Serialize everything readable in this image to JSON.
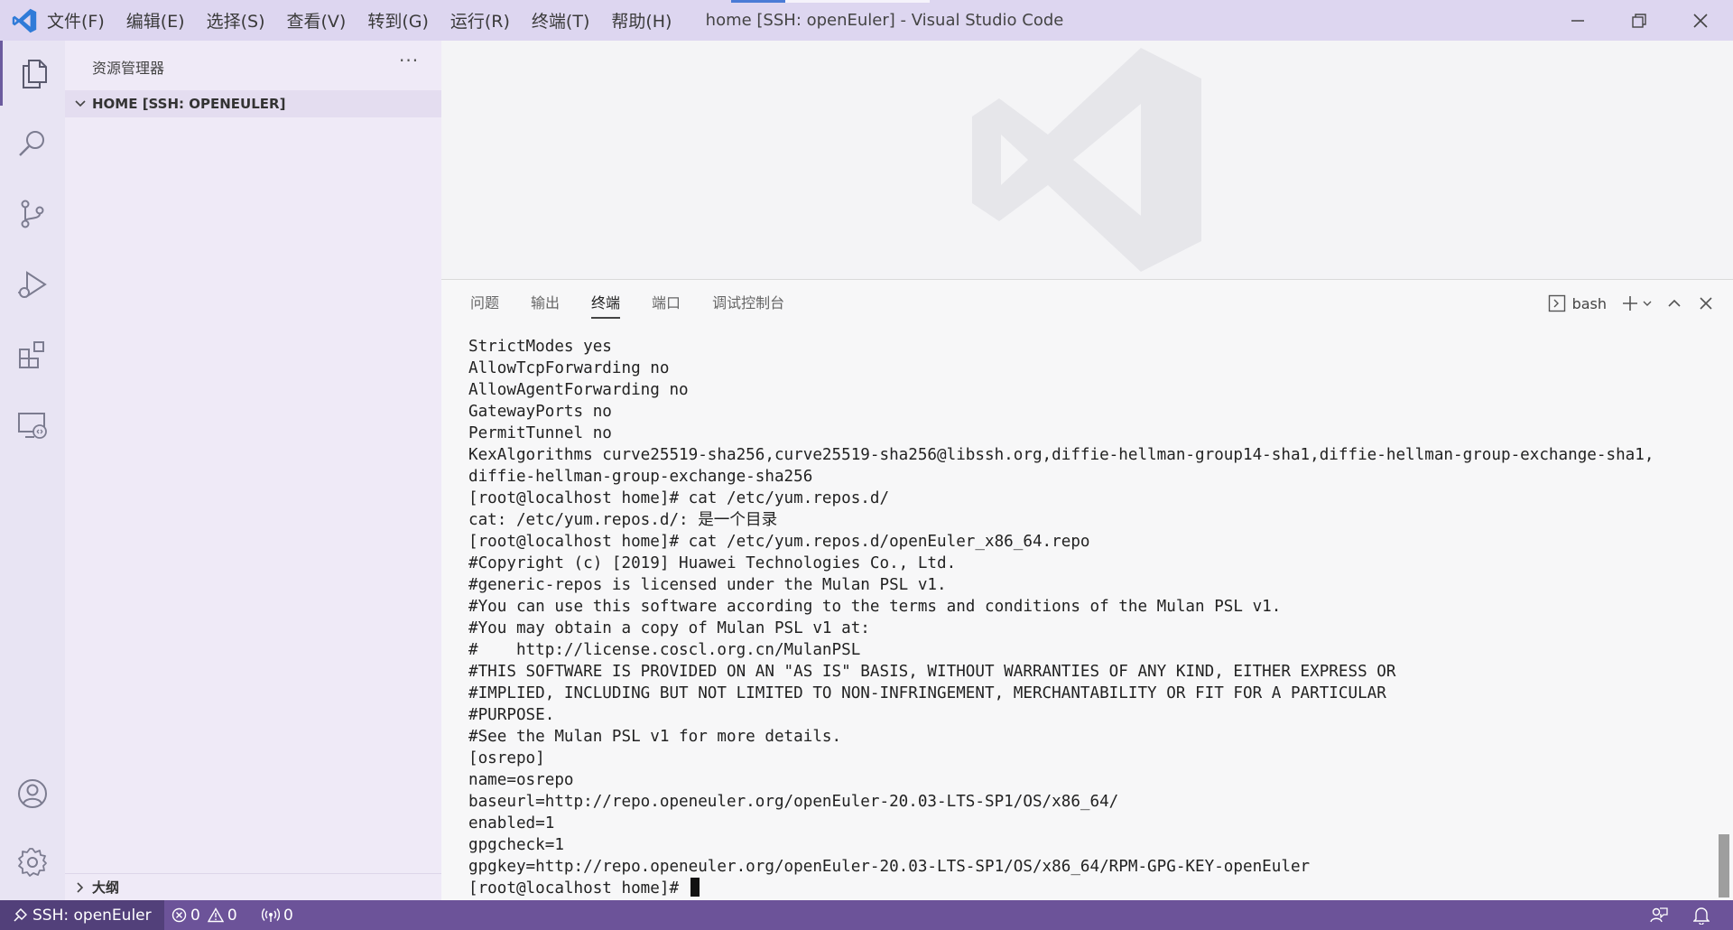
{
  "window": {
    "title": "home [SSH: openEuler] - Visual Studio Code"
  },
  "menu": [
    "文件(F)",
    "编辑(E)",
    "选择(S)",
    "查看(V)",
    "转到(G)",
    "运行(R)",
    "终端(T)",
    "帮助(H)"
  ],
  "activity": [
    {
      "name": "explorer",
      "icon": "files-icon"
    },
    {
      "name": "search",
      "icon": "search-icon"
    },
    {
      "name": "source-control",
      "icon": "source-control-icon"
    },
    {
      "name": "run-debug",
      "icon": "run-debug-icon"
    },
    {
      "name": "extensions",
      "icon": "extensions-icon"
    },
    {
      "name": "remote-explorer",
      "icon": "remote-explorer-icon"
    }
  ],
  "sidebar": {
    "header": "资源管理器",
    "more": "···",
    "folder_label": "HOME [SSH: OPENEULER]",
    "outline_label": "大纲"
  },
  "panel": {
    "tabs": [
      "问题",
      "输出",
      "终端",
      "端口",
      "调试控制台"
    ],
    "active_tab": "终端",
    "shell": "bash"
  },
  "terminal": {
    "lines": [
      "StrictModes yes",
      "AllowTcpForwarding no",
      "AllowAgentForwarding no",
      "GatewayPorts no",
      "PermitTunnel no",
      "KexAlgorithms curve25519-sha256,curve25519-sha256@libssh.org,diffie-hellman-group14-sha1,diffie-hellman-group-exchange-sha1,",
      "diffie-hellman-group-exchange-sha256",
      "[root@localhost home]# cat /etc/yum.repos.d/",
      "cat: /etc/yum.repos.d/: 是一个目录",
      "[root@localhost home]# cat /etc/yum.repos.d/openEuler_x86_64.repo",
      "#Copyright (c) [2019] Huawei Technologies Co., Ltd.",
      "#generic-repos is licensed under the Mulan PSL v1.",
      "#You can use this software according to the terms and conditions of the Mulan PSL v1.",
      "#You may obtain a copy of Mulan PSL v1 at:",
      "#    http://license.coscl.org.cn/MulanPSL",
      "#THIS SOFTWARE IS PROVIDED ON AN \"AS IS\" BASIS, WITHOUT WARRANTIES OF ANY KIND, EITHER EXPRESS OR",
      "#IMPLIED, INCLUDING BUT NOT LIMITED TO NON-INFRINGEMENT, MERCHANTABILITY OR FIT FOR A PARTICULAR",
      "#PURPOSE.",
      "#See the Mulan PSL v1 for more details.",
      "[osrepo]",
      "name=osrepo",
      "baseurl=http://repo.openeuler.org/openEuler-20.03-LTS-SP1/OS/x86_64/",
      "enabled=1",
      "gpgcheck=1",
      "gpgkey=http://repo.openeuler.org/openEuler-20.03-LTS-SP1/OS/x86_64/RPM-GPG-KEY-openEuler"
    ],
    "prompt": "[root@localhost home]# "
  },
  "status": {
    "remote": "SSH: openEuler",
    "errors": "0",
    "warnings": "0",
    "ports": "0"
  },
  "colors": {
    "titlebar": "#ddd6f0",
    "activitybar": "#e8e4f3",
    "statusbar": "#6c5399",
    "remote": "#52407a",
    "vscode_blue": "#2f7bd8"
  }
}
